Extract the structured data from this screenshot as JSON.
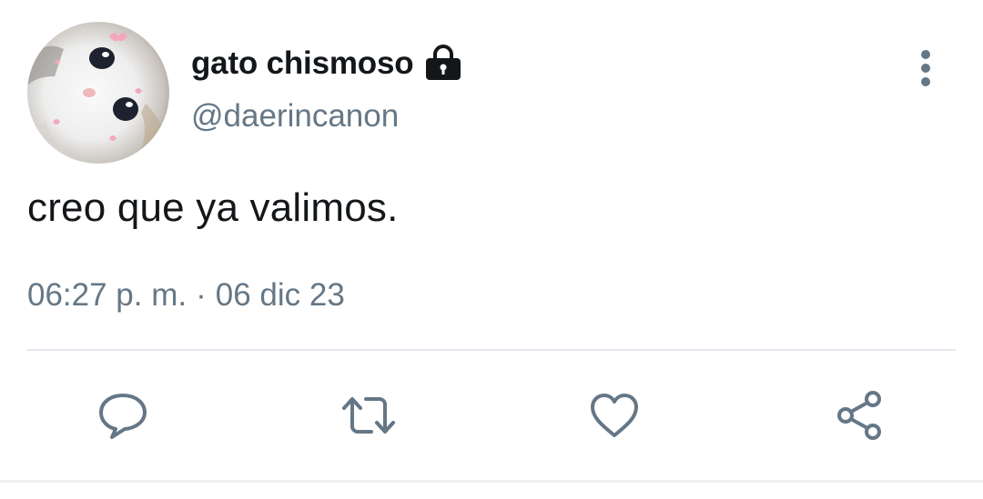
{
  "user": {
    "display_name": "gato chismoso",
    "handle": "@daerincanon",
    "protected_icon": "lock-icon",
    "avatar_icon": "cat-avatar"
  },
  "tweet": {
    "text": "creo que ya valimos.",
    "time": "06:27 p. m.",
    "separator": "·",
    "date": "06 dic 23"
  },
  "actions": [
    {
      "icon": "reply-icon"
    },
    {
      "icon": "retweet-icon"
    },
    {
      "icon": "like-icon"
    },
    {
      "icon": "share-icon"
    }
  ],
  "menu_icon": "more-vertical-icon",
  "colors": {
    "text": "#14171a",
    "secondary": "#657786",
    "divider": "#e1e8ed"
  }
}
